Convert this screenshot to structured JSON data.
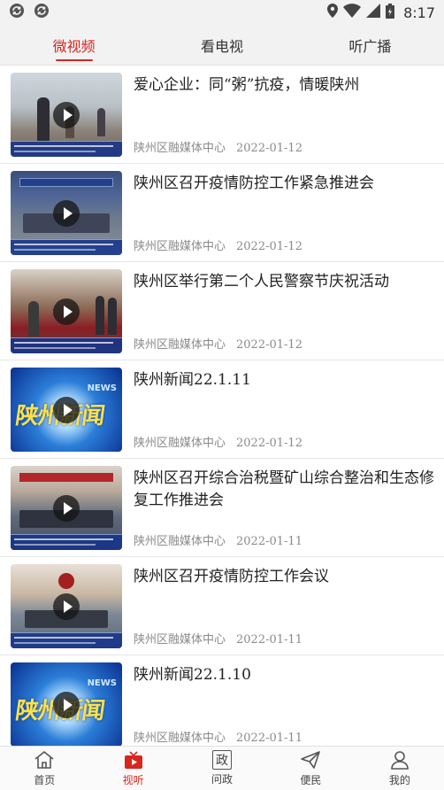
{
  "status_bar": {
    "time": "8:17"
  },
  "tabs": [
    {
      "label": "微视频",
      "active": true
    },
    {
      "label": "看电视",
      "active": false
    },
    {
      "label": "听广播",
      "active": false
    }
  ],
  "news": [
    {
      "title": "爱心企业：同“粥”抗疫，情暖陕州",
      "source": "陕州区融媒体中心",
      "date": "2022-01-12",
      "thumb": "outdoor"
    },
    {
      "title": "陕州区召开疫情防控工作紧急推进会",
      "source": "陕州区融媒体中心",
      "date": "2022-01-12",
      "thumb": "meeting"
    },
    {
      "title": "陕州区举行第二个人民警察节庆祝活动",
      "source": "陕州区融媒体中心",
      "date": "2022-01-12",
      "thumb": "police"
    },
    {
      "title": "陕州新闻22.1.11",
      "source": "陕州区融媒体中心",
      "date": "2022-01-12",
      "thumb": "news"
    },
    {
      "title": "陕州区召开综合治税暨矿山综合整治和生态修复工作推进会",
      "source": "陕州区融媒体中心",
      "date": "2022-01-11",
      "thumb": "meeting"
    },
    {
      "title": "陕州区召开疫情防控工作会议",
      "source": "陕州区融媒体中心",
      "date": "2022-01-11",
      "thumb": "meeting2"
    },
    {
      "title": "陕州新闻22.1.10",
      "source": "陕州区融媒体中心",
      "date": "2022-01-11",
      "thumb": "news"
    }
  ],
  "news_thumb_text": {
    "main": "陕州新闻",
    "tag": "NEWS"
  },
  "bottom_nav": [
    {
      "label": "首页",
      "icon": "home-icon",
      "active": false
    },
    {
      "label": "视听",
      "icon": "tv-icon",
      "active": true
    },
    {
      "label": "问政",
      "icon": "zheng-icon",
      "glyph": "政",
      "active": false
    },
    {
      "label": "便民",
      "icon": "send-icon",
      "active": false
    },
    {
      "label": "我的",
      "icon": "user-icon",
      "active": false
    }
  ],
  "colors": {
    "accent": "#d7261e",
    "tab_bg": "#f2f2f2",
    "meta": "#8a8a8a"
  }
}
